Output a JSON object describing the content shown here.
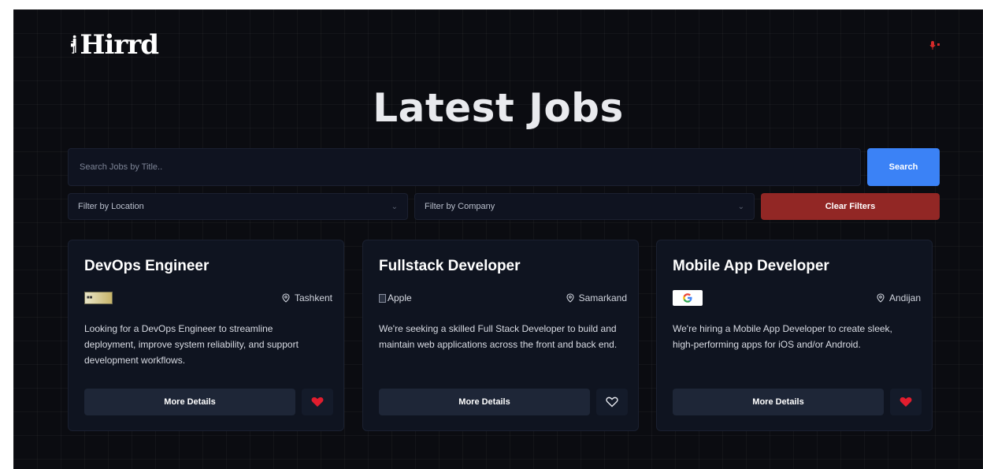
{
  "header": {
    "brand": "Hirrd",
    "mic_icon": "mic-icon",
    "accent": "#d42a2a"
  },
  "main": {
    "title": "Latest Jobs"
  },
  "search": {
    "placeholder": "Search Jobs by Title..",
    "value": "",
    "button_label": "Search"
  },
  "filters": {
    "location_placeholder": "Filter by Location",
    "company_placeholder": "Filter by Company",
    "clear_label": "Clear Filters"
  },
  "jobs": [
    {
      "title": "DevOps Engineer",
      "company_logo": "microsoft-logo",
      "location": "Tashkent",
      "description": "Looking for a DevOps Engineer to streamline deployment, improve system reliability, and support development workflows.",
      "details_label": "More Details",
      "saved": true
    },
    {
      "title": "Fullstack Developer",
      "company_logo_alt": "Apple",
      "location": "Samarkand",
      "description": "We're seeking a skilled Full Stack Developer to build and maintain web applications across the front and back end.",
      "details_label": "More Details",
      "saved": false
    },
    {
      "title": "Mobile App Developer",
      "company_logo": "google-logo",
      "location": "Andijan",
      "description": "We're hiring a Mobile App Developer to create sleek, high-performing apps for iOS and/or Android.",
      "details_label": "More Details",
      "saved": true
    }
  ],
  "colors": {
    "background": "#0b0c11",
    "card": "#0f1420",
    "primary": "#3b82f6",
    "danger": "#922725",
    "heart": "#e11d2e"
  }
}
